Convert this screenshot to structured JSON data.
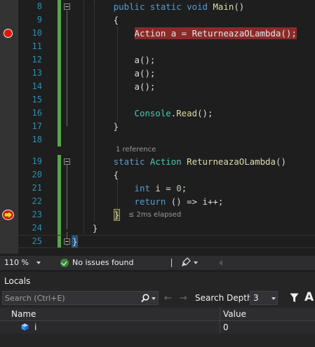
{
  "editor": {
    "lines": [
      {
        "num": "8",
        "tokens": [
          [
            "        ",
            ""
          ],
          [
            "public",
            "kw"
          ],
          [
            " ",
            ""
          ],
          [
            "static",
            "kw"
          ],
          [
            " ",
            ""
          ],
          [
            "void",
            "kw"
          ],
          [
            " ",
            ""
          ],
          [
            "Main",
            "fn"
          ],
          [
            "()",
            ""
          ]
        ]
      },
      {
        "num": "9",
        "tokens": [
          [
            "        {",
            ""
          ]
        ]
      },
      {
        "num": "10",
        "tokens": [
          [
            "            ",
            ""
          ],
          [
            "Action a = ReturneazaOLambda();",
            "bp-hl"
          ]
        ]
      },
      {
        "num": "11",
        "tokens": []
      },
      {
        "num": "12",
        "tokens": [
          [
            "            ",
            ""
          ],
          [
            "a",
            ""
          ],
          [
            "();",
            ""
          ]
        ]
      },
      {
        "num": "13",
        "tokens": [
          [
            "            ",
            ""
          ],
          [
            "a",
            ""
          ],
          [
            "();",
            ""
          ]
        ]
      },
      {
        "num": "14",
        "tokens": [
          [
            "            ",
            ""
          ],
          [
            "a",
            ""
          ],
          [
            "();",
            ""
          ]
        ]
      },
      {
        "num": "15",
        "tokens": []
      },
      {
        "num": "16",
        "tokens": [
          [
            "            ",
            ""
          ],
          [
            "Console",
            "ty"
          ],
          [
            ".",
            ""
          ],
          [
            "Read",
            "fn"
          ],
          [
            "();",
            ""
          ]
        ]
      },
      {
        "num": "17",
        "tokens": [
          [
            "        }",
            ""
          ]
        ]
      },
      {
        "num": "18",
        "tokens": []
      },
      {
        "num": "19",
        "tokens": [
          [
            "        ",
            ""
          ],
          [
            "static",
            "kw"
          ],
          [
            " ",
            ""
          ],
          [
            "Action",
            "ty"
          ],
          [
            " ",
            ""
          ],
          [
            "ReturneazaOLambda",
            "fn"
          ],
          [
            "()",
            ""
          ]
        ]
      },
      {
        "num": "20",
        "tokens": [
          [
            "        {",
            ""
          ]
        ]
      },
      {
        "num": "21",
        "tokens": [
          [
            "            ",
            ""
          ],
          [
            "int",
            "kw"
          ],
          [
            " i = ",
            ""
          ],
          [
            "0",
            "num"
          ],
          [
            ";",
            ""
          ]
        ]
      },
      {
        "num": "22",
        "tokens": [
          [
            "            ",
            ""
          ],
          [
            "return",
            "kw"
          ],
          [
            " () => i++;",
            ""
          ]
        ]
      },
      {
        "num": "23",
        "tokens": [
          [
            "        ",
            ""
          ],
          [
            "}",
            "brace-hl"
          ]
        ]
      },
      {
        "num": "24",
        "tokens": [
          [
            "    }",
            ""
          ]
        ]
      },
      {
        "num": "25",
        "tokens": [
          [
            "",
            ""
          ],
          [
            "}",
            "caret-box"
          ]
        ]
      }
    ],
    "codelens": "1 reference",
    "elapsed": "≤ 2ms elapsed"
  },
  "status": {
    "zoom": "110 %",
    "issues": "No issues found"
  },
  "locals": {
    "title": "Locals",
    "search_placeholder": "Search (Ctrl+E)",
    "search_depth_label": "Search Depth:",
    "search_depth_value": "3",
    "font_button": "A",
    "columns": {
      "name": "Name",
      "value": "Value"
    },
    "rows": [
      {
        "name": "i",
        "value": "0"
      }
    ]
  },
  "colors": {
    "background": "#1e1e1e",
    "line_numbers": "#2b91af",
    "keyword": "#569cd6",
    "type": "#4ec9b0",
    "method": "#dcdcaa",
    "breakpoint": "#e51400",
    "change_bar": "#57a64a"
  },
  "icons": [
    "breakpoint-icon",
    "breakpoint-current-icon",
    "fold-icon",
    "check-circle-icon",
    "brush-icon",
    "search-icon",
    "filter-icon",
    "local-variable-icon"
  ]
}
